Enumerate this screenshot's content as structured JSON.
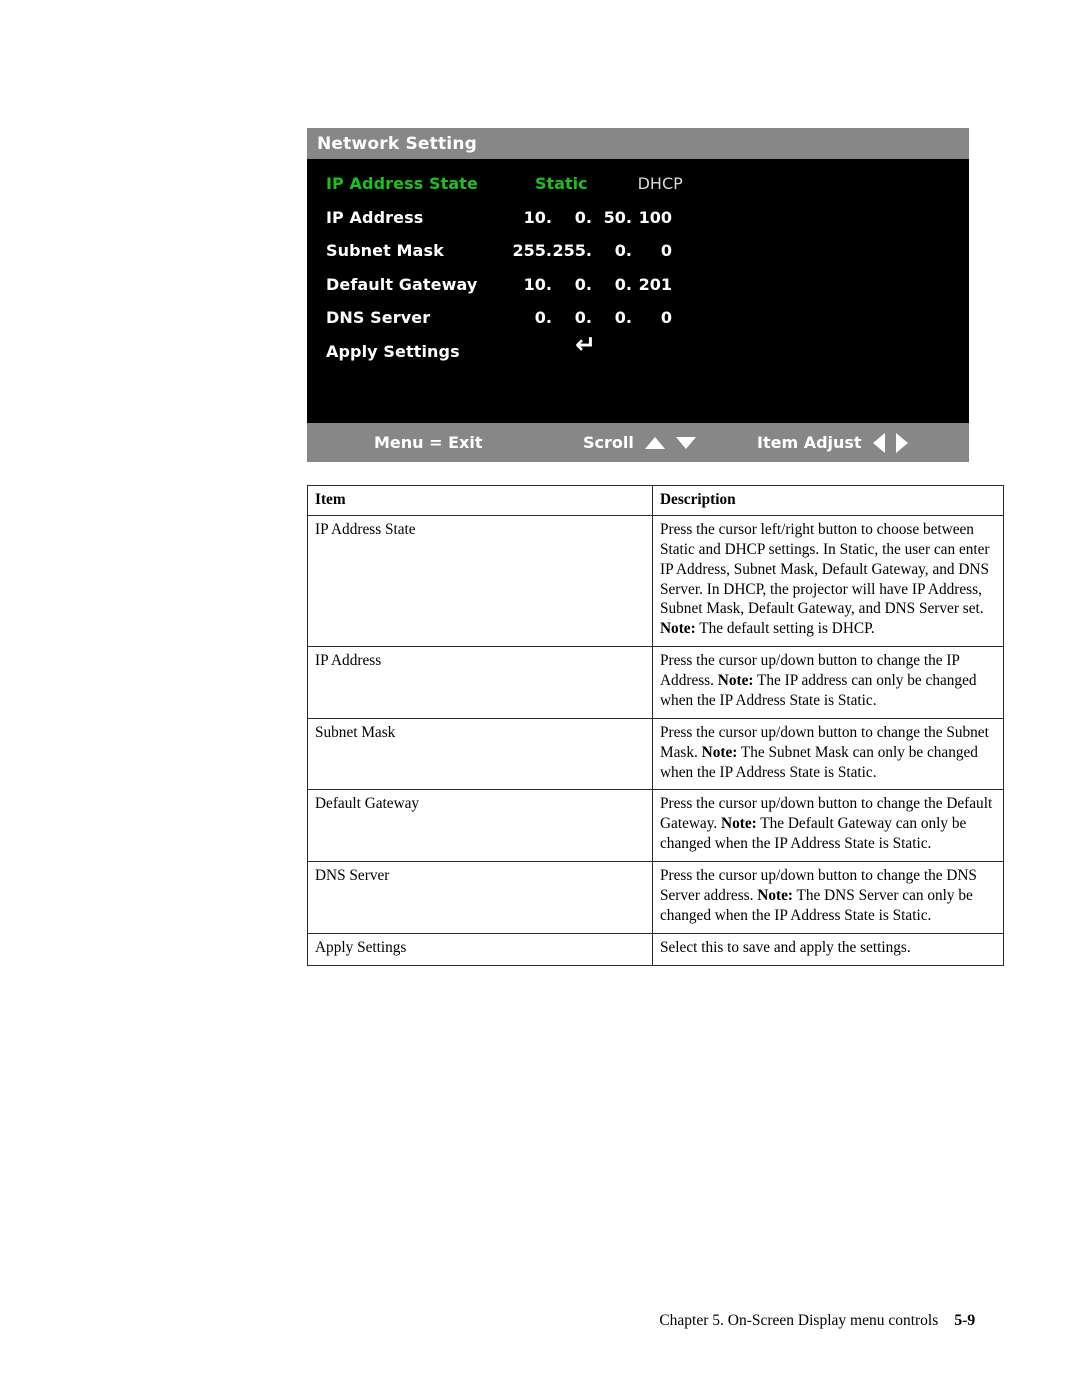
{
  "osd": {
    "title": "Network Setting",
    "rows": [
      {
        "label": "IP Address State",
        "selected": true,
        "type": "options",
        "options": [
          {
            "label": "Static",
            "active": true
          },
          {
            "label": "DHCP",
            "active": false
          }
        ]
      },
      {
        "label": "IP Address",
        "selected": false,
        "type": "octets",
        "octets": [
          "10.",
          "0.",
          "50.",
          "100"
        ]
      },
      {
        "label": "Subnet Mask",
        "selected": false,
        "type": "octets",
        "octets": [
          "255.",
          "255.",
          "0.",
          "0"
        ]
      },
      {
        "label": "Default Gateway",
        "selected": false,
        "type": "octets",
        "octets": [
          "10.",
          "0.",
          "0.",
          "201"
        ]
      },
      {
        "label": "DNS Server",
        "selected": false,
        "type": "octets",
        "octets": [
          "0.",
          "0.",
          "0.",
          "0"
        ]
      },
      {
        "label": "Apply Settings",
        "selected": false,
        "type": "action",
        "action_glyph": "enter-return-arrow-icon"
      }
    ],
    "footer": {
      "menu": "Menu = Exit",
      "scroll": "Scroll",
      "item_adjust": "Item Adjust"
    },
    "colors": {
      "titlebar": "#878787",
      "background": "#000000",
      "selected_text": "#16c31a",
      "text": "#ffffff",
      "dim_text": "#d9d9d9"
    }
  },
  "table": {
    "headers": {
      "item": "Item",
      "description": "Description"
    },
    "rows": [
      {
        "item": "IP Address State",
        "description": "Press the cursor left/right button to choose between Static and DHCP settings. In Static, the user can enter IP Address, Subnet Mask, Default Gateway, and DNS Server. In DHCP, the projector will have IP Address, Subnet Mask, Default Gateway, and DNS Server set.",
        "note_label": "Note:",
        "note": "The default setting is DHCP."
      },
      {
        "item": "IP Address",
        "description": "Press the cursor up/down button to change the IP Address.",
        "note_label": "Note:",
        "note": "The IP address can only be changed when the IP Address State is Static."
      },
      {
        "item": "Subnet Mask",
        "description": "Press the cursor up/down button to change the Subnet Mask.",
        "note_label": "Note:",
        "note": "The Subnet Mask can only be changed when the IP Address State is Static."
      },
      {
        "item": "Default Gateway",
        "description": "Press the cursor up/down button to change the Default Gateway.",
        "note_label": "Note:",
        "note": "The Default Gateway can only be changed when the IP Address State is Static."
      },
      {
        "item": "DNS Server",
        "description": "Press the cursor up/down button to change the DNS Server address.",
        "note_label": "Note:",
        "note": "The DNS Server can only be changed when the IP Address State is Static."
      },
      {
        "item": "Apply Settings",
        "description": "Select this to save and apply the settings.",
        "note_label": "",
        "note": ""
      }
    ]
  },
  "page_footer": {
    "chapter": "Chapter 5. On-Screen Display menu controls",
    "page": "5-9"
  }
}
